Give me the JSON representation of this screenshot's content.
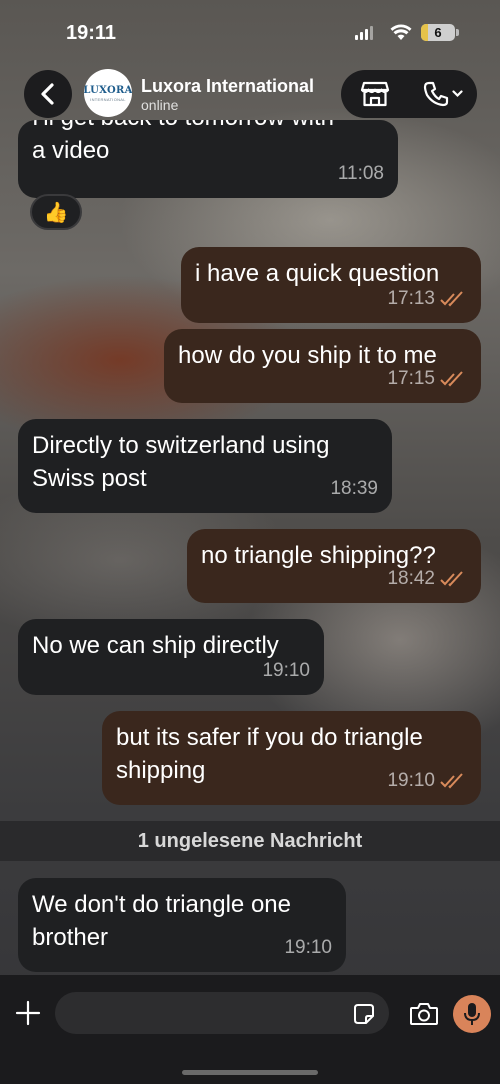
{
  "status_bar": {
    "time": "19:11",
    "battery": "6"
  },
  "header": {
    "contact_name": "Luxora International",
    "contact_status": "online",
    "avatar_brand": "LUXORA",
    "avatar_sub": "INTERNATIONAL"
  },
  "messages": [
    {
      "direction": "incoming",
      "text": "I'll get back to tomorrow with a video",
      "time": "11:08"
    },
    {
      "direction": "outgoing",
      "text": "i have a quick question",
      "time": "17:13"
    },
    {
      "direction": "outgoing",
      "text": "how do you ship it to me",
      "time": "17:15"
    },
    {
      "direction": "incoming",
      "text": "Directly to switzerland using Swiss post",
      "time": "18:39"
    },
    {
      "direction": "outgoing",
      "text": "no triangle shipping??",
      "time": "18:42"
    },
    {
      "direction": "incoming",
      "text": "No we can ship directly",
      "time": "19:10"
    },
    {
      "direction": "outgoing",
      "text": "but its safer if you do triangle shipping",
      "time": "19:10"
    },
    {
      "direction": "incoming",
      "text": "We don't do triangle one brother",
      "time": "19:10"
    }
  ],
  "reaction": "👍",
  "unread_banner": "1 ungelesene Nachricht",
  "composer": {
    "placeholder": ""
  },
  "colors": {
    "incoming_bubble": "#1f2022",
    "outgoing_bubble": "#3a271d",
    "mic_button": "#d9845a",
    "read_tick": "#d88a5b"
  },
  "icons": [
    "back-icon",
    "store-icon",
    "phone-icon",
    "chevron-down-icon",
    "plus-icon",
    "sticker-icon",
    "camera-icon",
    "microphone-icon",
    "double-check-icon"
  ]
}
